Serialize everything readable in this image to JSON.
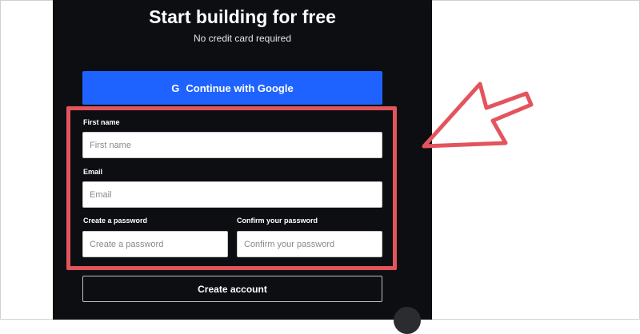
{
  "header": {
    "title": "Start building for free",
    "subtitle": "No credit card required"
  },
  "google_button": {
    "label": "Continue with Google",
    "icon": "G"
  },
  "form": {
    "first_name": {
      "label": "First name",
      "placeholder": "First name"
    },
    "email": {
      "label": "Email",
      "placeholder": "Email"
    },
    "password": {
      "label": "Create a password",
      "placeholder": "Create a password"
    },
    "confirm_password": {
      "label": "Confirm your password",
      "placeholder": "Confirm your password"
    }
  },
  "create_button": {
    "label": "Create account"
  },
  "colors": {
    "panel_bg": "#0d0e12",
    "google_blue": "#1e63ff",
    "highlight_red": "#e3545d"
  }
}
